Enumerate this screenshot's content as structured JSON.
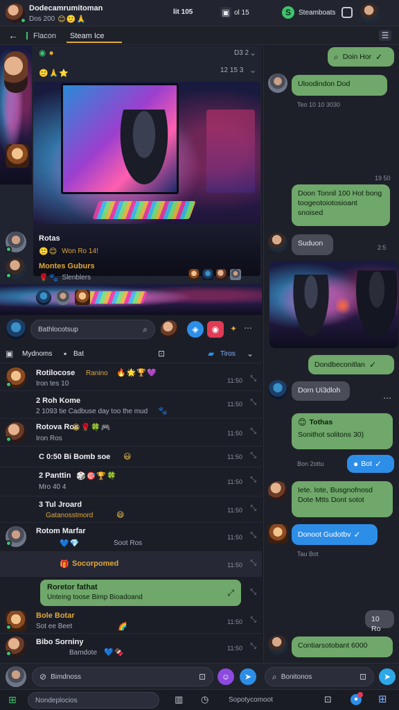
{
  "topbar": {
    "user_name": "Dodecamrumitoman",
    "user_status": "Dos 200",
    "status_emojis": "😊🙂🙏",
    "center_label": "lit 105",
    "center_badge": "ol 15",
    "right_label": "Steamboats"
  },
  "nav": {
    "tabs": [
      "Flacon",
      "Steam Ice"
    ]
  },
  "media_card": {
    "meta_time_1": "D3 2",
    "meta_time_2": "12 15 3",
    "caption_name": "Rotas",
    "caption_sub": "Won Ro 14!",
    "caption_title": "Montes Guburs",
    "caption_tags": "Slenblers"
  },
  "search": {
    "placeholder": "Bathlocotsup"
  },
  "filters": {
    "left": "Mydnoms",
    "mid": "Bat",
    "right": "Tiros"
  },
  "list": [
    {
      "name": "Rotilocose",
      "sub": "Iron tes 10",
      "badge": "Ranino",
      "time": "11:50",
      "emojis": "🔥🌟🏆💜"
    },
    {
      "name": "2  Roh Kome",
      "sub": "2  1093 tie  Cadbuse day too the mud",
      "time": "11:50",
      "emojis": "🐾"
    },
    {
      "name": "Rotova Ros",
      "sub": "Iron Ros",
      "time": "11:50",
      "emojis": "😀🌹🍀🎮"
    },
    {
      "name": "C  0:50 Bi  Bomb soe",
      "sub": "",
      "time": "11:50",
      "emojis": "😃"
    },
    {
      "name": "2  Panttin",
      "sub": "Mro 40 4",
      "time": "11:50",
      "emojis": "🎲🎯🏆🍀"
    },
    {
      "name": "3  Tul Jroard",
      "sub": "Gatanosstmord",
      "time": "11:50",
      "emojis": "😄"
    },
    {
      "name": "Rotom Marfar",
      "sub": "Soot Ros",
      "time": "11:50",
      "emojis": "💙💎"
    },
    {
      "name": "Socorpomed",
      "sub": "",
      "time": "11:50",
      "emojis": "🎁"
    },
    {
      "name": "Roretor fathat",
      "sub": "Unteing toose Bimp Bioadoand",
      "time": "",
      "emojis": ""
    },
    {
      "name": "Bole Botar",
      "sub": "Sot ee Beet",
      "time": "11:50",
      "emojis": "🌈"
    },
    {
      "name": "Bibo Sorniny",
      "sub": "Bamdote",
      "time": "11:50",
      "emojis": "💙🍫"
    }
  ],
  "chat": {
    "messages": [
      {
        "text": "Doin Hor",
        "type": "sent"
      },
      {
        "text": "Uloodindon Dod",
        "type": "recv"
      },
      {
        "text": "Teo 10 10 3030",
        "type": "time"
      },
      {
        "text": "19 50",
        "type": "time"
      },
      {
        "text": "Doon Tonnil 100 Hot bong toogeotoiotosioant snoised",
        "type": "sent"
      },
      {
        "text": "Suduon",
        "type": "recv"
      },
      {
        "text": "2:5",
        "type": "time"
      },
      {
        "text": "Dondbeconitlan",
        "type": "sent"
      },
      {
        "text": "Dorn Ui3dloh",
        "type": "recv"
      },
      {
        "text": "Tothas",
        "type": "sent"
      },
      {
        "text": "Sonithot solitons 30)",
        "type": "sent"
      },
      {
        "text": "Bon 2ottu",
        "type": "time"
      },
      {
        "text": "Bot",
        "type": "sent-blue"
      },
      {
        "text": "Iete. Iote, Busgnofnosd Dote Mtts Dont sotot",
        "type": "recv"
      },
      {
        "text": "Donoot Gudotbv",
        "type": "recv-blue"
      },
      {
        "text": "Tau Bot",
        "type": "time"
      },
      {
        "text": "10 Ro",
        "type": "sent-gray"
      },
      {
        "text": "Contiarsotobant 6000",
        "type": "recv"
      }
    ]
  },
  "composer": {
    "left_placeholder": "Bimdnoss",
    "right_placeholder": "Bonitonos"
  },
  "bottomnav": {
    "search_placeholder": "Nondeplocios",
    "mid_label": "Sopotycomoot"
  }
}
